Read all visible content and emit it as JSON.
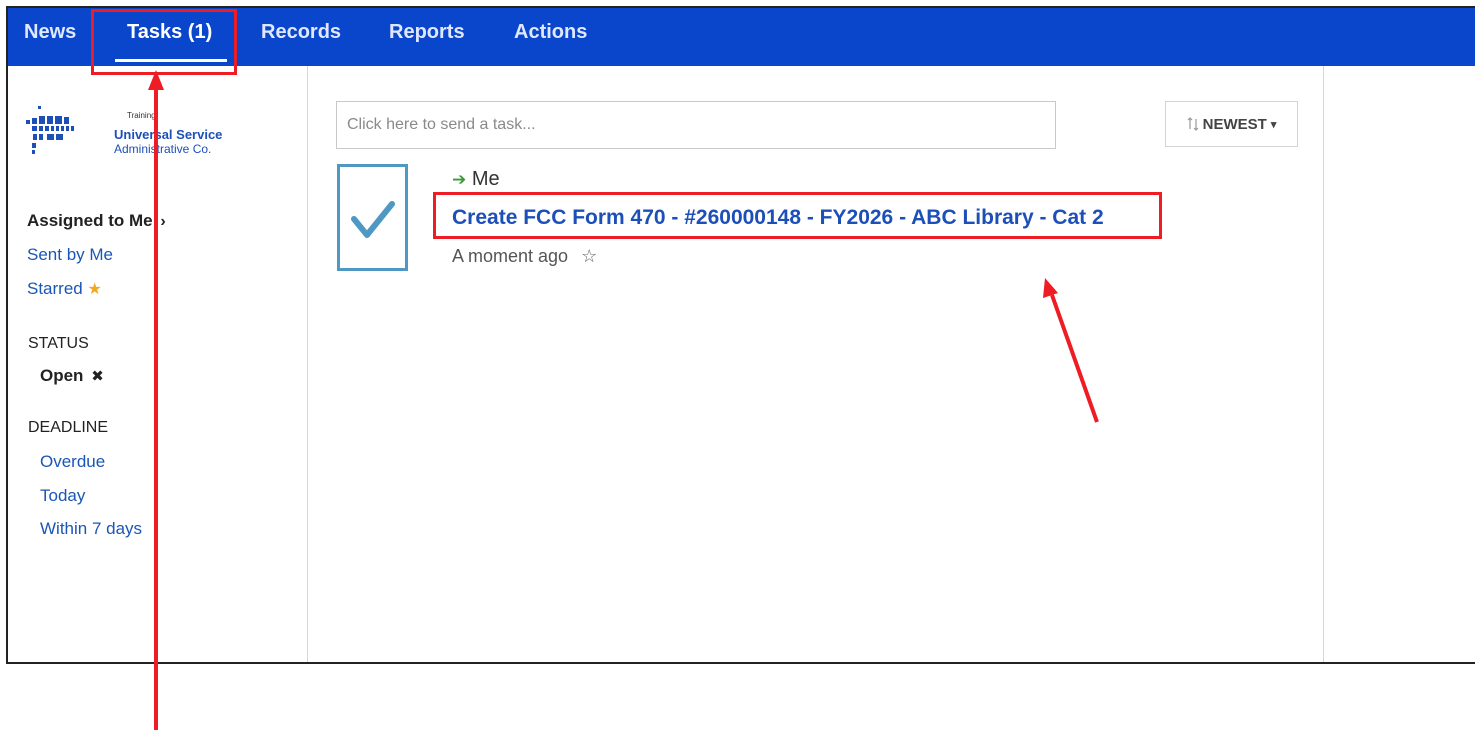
{
  "nav": {
    "items": [
      {
        "label": "News"
      },
      {
        "label": "Tasks (1)"
      },
      {
        "label": "Records"
      },
      {
        "label": "Reports"
      },
      {
        "label": "Actions"
      }
    ],
    "active": "Tasks (1)"
  },
  "logo": {
    "small": "Training",
    "line1": "Universal Service",
    "line2": "Administrative Co."
  },
  "sidebar": {
    "assigned_to_me": "Assigned to Me",
    "sent_by_me": "Sent by Me",
    "starred": "Starred",
    "status_heading": "STATUS",
    "status_open": "Open",
    "deadline_heading": "DEADLINE",
    "deadline_items": [
      "Overdue",
      "Today",
      "Within 7 days"
    ]
  },
  "task_input": {
    "placeholder": "Click here to send a task..."
  },
  "sort": {
    "label": "NEWEST"
  },
  "task": {
    "assignee": "Me",
    "title": "Create FCC Form 470 - #260000148 - FY2026 - ABC Library - Cat 2",
    "time": "A moment ago"
  },
  "colors": {
    "nav_bg": "#0a46cc",
    "link": "#1d4fb8",
    "annotation": "#ee1c24",
    "check": "#4f98c3",
    "star": "#f0a920",
    "arrow_green": "#3a9a3a"
  },
  "icons": {
    "chevron": "chevron-right-icon",
    "star_filled": "star-filled-icon",
    "close": "close-icon",
    "sort": "sort-arrows-icon",
    "caret": "caret-down-icon",
    "check": "checkmark-icon",
    "assignee_arrow": "arrow-right-icon",
    "star_outline": "star-outline-icon"
  }
}
